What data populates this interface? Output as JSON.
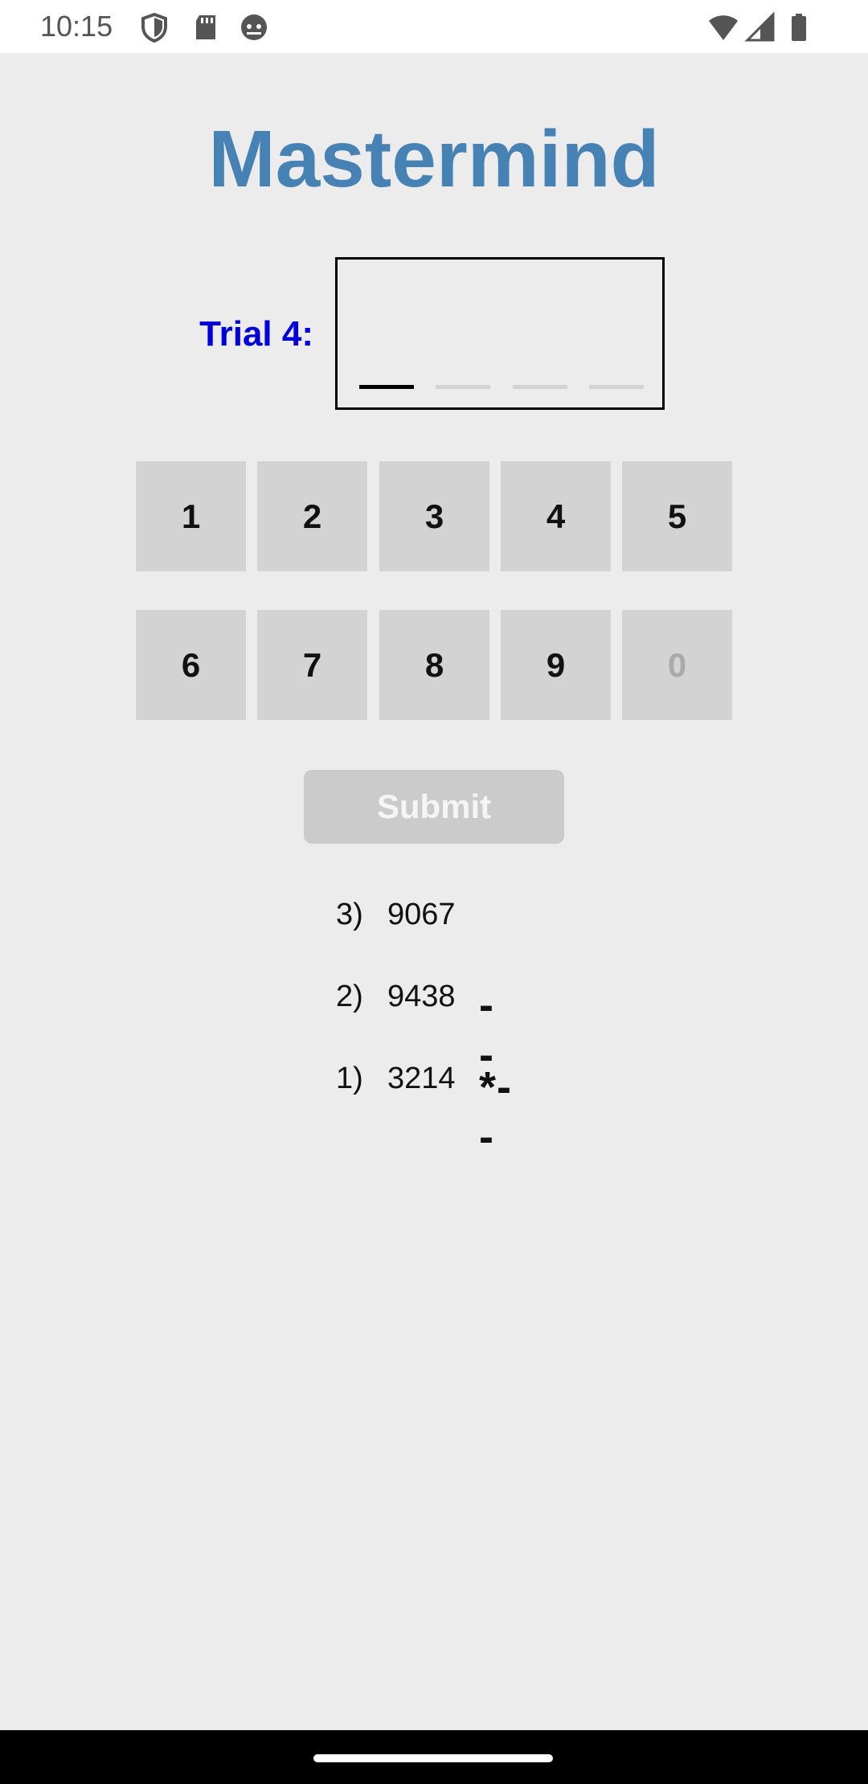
{
  "status_bar": {
    "time": "10:15",
    "left_icons": [
      "shield-icon",
      "sd-card-icon",
      "android-debug-icon"
    ],
    "right_icons": [
      "wifi-icon",
      "cell-signal-icon",
      "battery-icon"
    ]
  },
  "app": {
    "title": "Mastermind",
    "title_color": "#4682b4"
  },
  "trial": {
    "label": "Trial 4:",
    "label_color": "#0000dd",
    "slot_count": 4,
    "active_slot": 1
  },
  "keypad": {
    "keys": [
      "1",
      "2",
      "3",
      "4",
      "5",
      "6",
      "7",
      "8",
      "9",
      "0"
    ],
    "disabled_keys": [
      "0"
    ]
  },
  "submit": {
    "label": "Submit",
    "enabled": false
  },
  "history": [
    {
      "index": "3)",
      "guess": "9067",
      "feedback": ""
    },
    {
      "index": "2)",
      "guess": "9438",
      "feedback": "--"
    },
    {
      "index": "1)",
      "guess": "3214",
      "feedback": "*--"
    }
  ]
}
